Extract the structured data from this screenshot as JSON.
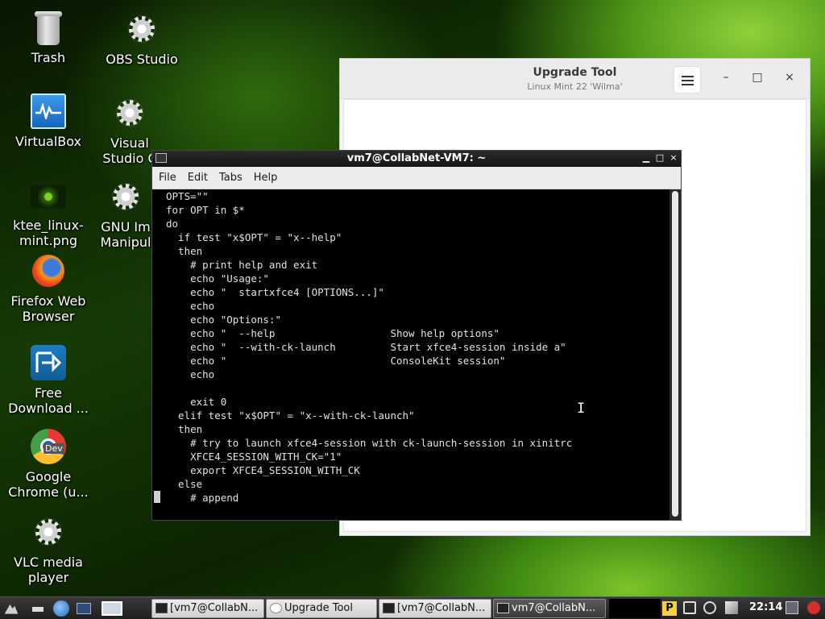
{
  "desktop": {
    "icons": [
      {
        "label": "Trash",
        "icon": "trash-icon"
      },
      {
        "label": "OBS Studio",
        "icon": "gear-icon"
      },
      {
        "label": "VirtualBox",
        "icon": "virtualbox-icon"
      },
      {
        "label": "Visual Studio C",
        "icon": "gear-icon"
      },
      {
        "label": "ktee_linux-mint.png",
        "icon": "image-file-icon"
      },
      {
        "label": "GNU Im Manipul",
        "icon": "gear-icon"
      },
      {
        "label": "Firefox Web Browser",
        "icon": "firefox-icon"
      },
      {
        "label": "Free Download ...",
        "icon": "free-download-manager-icon"
      },
      {
        "label": "Google Chrome (u...",
        "icon": "chrome-dev-icon",
        "badge": "Dev"
      },
      {
        "label": "VLC media player",
        "icon": "gear-icon"
      }
    ]
  },
  "upgrade_window": {
    "title": "Upgrade Tool",
    "subtitle": "Linux Mint 22 'Wilma'",
    "controls": {
      "minimize": "–",
      "maximize": "□",
      "close": "×"
    }
  },
  "terminal": {
    "title": "vm7@CollabNet-VM7: ~",
    "menu": [
      "File",
      "Edit",
      "Tabs",
      "Help"
    ],
    "controls": {
      "minimize": "▁",
      "maximize": "□",
      "close": "×"
    },
    "lines": [
      "OPTS=\"\"",
      "for OPT in $*",
      "do",
      "  if test \"x$OPT\" = \"x--help\"",
      "  then",
      "    # print help and exit",
      "    echo \"Usage:\"",
      "    echo \"  startxfce4 [OPTIONS...]\"",
      "    echo",
      "    echo \"Options:\"",
      "    echo \"  --help                   Show help options\"",
      "    echo \"  --with-ck-launch         Start xfce4-session inside a\"",
      "    echo \"                           ConsoleKit session\"",
      "    echo",
      "",
      "    exit 0",
      "  elif test \"x$OPT\" = \"x--with-ck-launch\"",
      "  then",
      "    # try to launch xfce4-session with ck-launch-session in xinitrc",
      "    XFCE4_SESSION_WITH_CK=\"1\"",
      "    export XFCE4_SESSION_WITH_CK",
      "  else",
      "    # append"
    ]
  },
  "taskbar": {
    "tasks": [
      {
        "label": "[vm7@CollabN...",
        "active": false,
        "icon": "terminal-icon"
      },
      {
        "label": "Upgrade Tool",
        "active": false,
        "icon": "upgrade-icon"
      },
      {
        "label": "[vm7@CollabN...",
        "active": false,
        "icon": "terminal-icon"
      },
      {
        "label": "vm7@CollabN...",
        "active": true,
        "icon": "terminal-icon"
      }
    ],
    "clock": "22:14",
    "tray_letter": "P"
  }
}
